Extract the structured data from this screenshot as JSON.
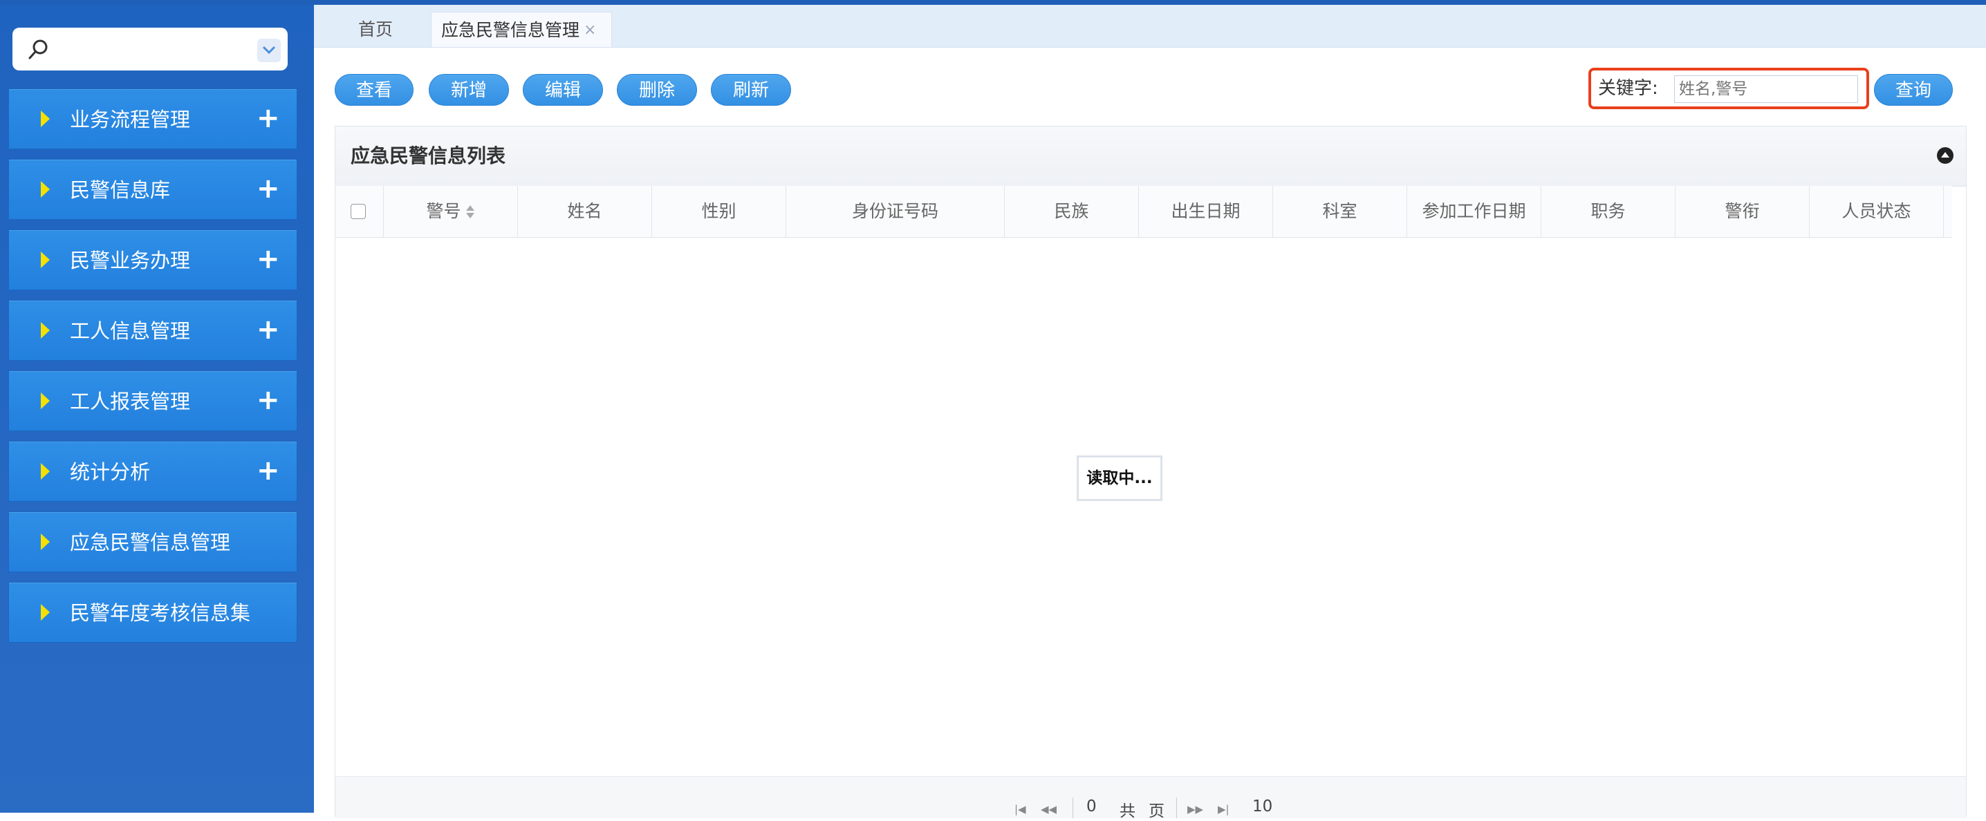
{
  "search": {
    "placeholder": ""
  },
  "sidebar": {
    "items": [
      {
        "label": "业务流程管理",
        "expand": "+"
      },
      {
        "label": "民警信息库",
        "expand": "+"
      },
      {
        "label": "民警业务办理",
        "expand": "+"
      },
      {
        "label": "工人信息管理",
        "expand": "+"
      },
      {
        "label": "工人报表管理",
        "expand": "+"
      },
      {
        "label": "统计分析",
        "expand": "+"
      },
      {
        "label": "应急民警信息管理",
        "expand": ""
      },
      {
        "label": "民警年度考核信息集",
        "expand": ""
      }
    ]
  },
  "tabs": {
    "home": "首页",
    "active": "应急民警信息管理",
    "close": "×"
  },
  "toolbar": {
    "view": "查看",
    "add": "新增",
    "edit": "编辑",
    "delete": "删除",
    "refresh": "刷新",
    "keyword_label": "关键字:",
    "keyword_placeholder": "姓名,警号",
    "query": "查询"
  },
  "panel": {
    "title": "应急民警信息列表",
    "columns": [
      "警号",
      "姓名",
      "性别",
      "身份证号码",
      "民族",
      "出生日期",
      "科室",
      "参加工作日期",
      "职务",
      "警衔",
      "人员状态"
    ],
    "loading": "读取中..."
  },
  "pager": {
    "page": "0",
    "total_label": "共",
    "page_unit": "页",
    "page_size": "10"
  },
  "colors": {
    "sidebar_bg": "#1f63c0",
    "nav_item": "#2a88e2",
    "button": "#3a96e6",
    "highlight_border": "#e8401c",
    "arrow": "#f5e000"
  }
}
